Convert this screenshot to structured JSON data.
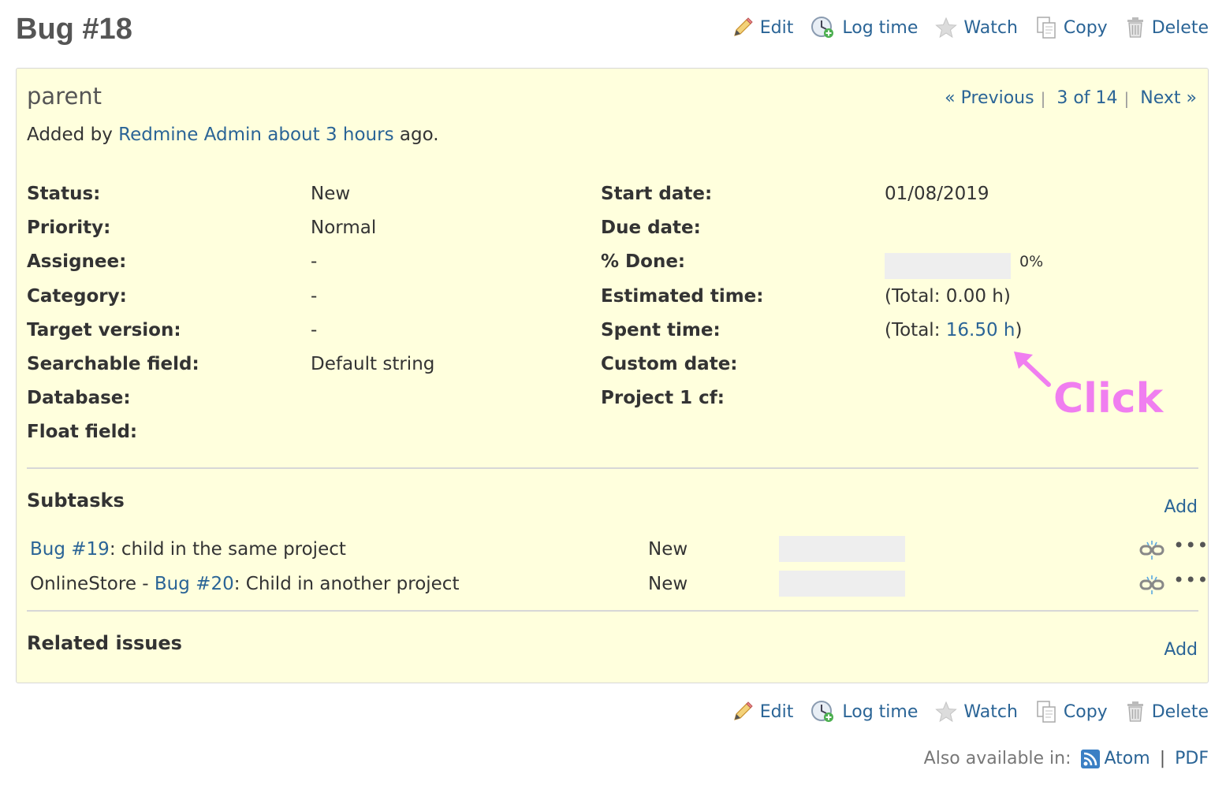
{
  "issue": {
    "title": "Bug #18",
    "subject": "parent",
    "added_by_prefix": "Added by ",
    "author": "Redmine Admin",
    "age": "about 3 hours",
    "added_by_suffix": " ago."
  },
  "actions": {
    "edit": "Edit",
    "log_time": "Log time",
    "watch": "Watch",
    "copy": "Copy",
    "delete": "Delete"
  },
  "navigation": {
    "previous": "« Previous",
    "position": "3 of 14",
    "next": "Next »",
    "separator": "|"
  },
  "attributes_left": [
    {
      "label": "Status:",
      "value": "New"
    },
    {
      "label": "Priority:",
      "value": "Normal"
    },
    {
      "label": "Assignee:",
      "value": "-"
    },
    {
      "label": "Category:",
      "value": "-"
    },
    {
      "label": "Target version:",
      "value": "-"
    },
    {
      "label": "Searchable field:",
      "value": "Default string"
    },
    {
      "label": "Database:",
      "value": ""
    },
    {
      "label": "Float field:",
      "value": ""
    }
  ],
  "attributes_right": {
    "start_date": {
      "label": "Start date:",
      "value": "01/08/2019"
    },
    "due_date": {
      "label": "Due date:",
      "value": ""
    },
    "done": {
      "label": "% Done:",
      "value": "0%",
      "fraction": 0
    },
    "estimated": {
      "label": "Estimated time:",
      "value": "(Total: 0.00 h)"
    },
    "spent": {
      "label": "Spent time:",
      "prefix": "(Total: ",
      "link": "16.50 h",
      "suffix": ")"
    },
    "custom_date": {
      "label": "Custom date:",
      "value": ""
    },
    "project_cf": {
      "label": "Project 1 cf:",
      "value": ""
    }
  },
  "subtasks": {
    "title": "Subtasks",
    "add_label": "Add",
    "items": [
      {
        "prefix": "",
        "link": "Bug #19",
        "text": ": child in the same project",
        "status": "New",
        "done_fraction": 0
      },
      {
        "prefix": "OnlineStore - ",
        "link": "Bug #20",
        "text": ": Child in another project",
        "status": "New",
        "done_fraction": 0
      }
    ]
  },
  "related": {
    "title": "Related issues",
    "add_label": "Add"
  },
  "footer": {
    "also_available": "Also available in:",
    "atom": "Atom",
    "separator": "|",
    "pdf": "PDF"
  },
  "annotation": {
    "text": "Click",
    "color": "#f07ef0"
  },
  "colors": {
    "link": "#2a6496",
    "box_background": "#ffffdd",
    "progress_empty": "#eeeeee"
  },
  "icons": [
    "pencil-icon",
    "clock-add-icon",
    "star-icon",
    "copy-icon",
    "trash-icon",
    "unlink-icon",
    "rss-icon"
  ]
}
